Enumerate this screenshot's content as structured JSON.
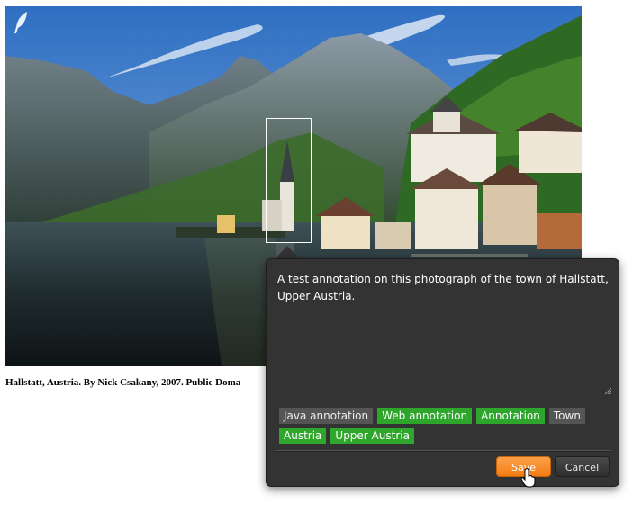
{
  "image": {
    "caption": "Hallstatt, Austria. By Nick Csakany, 2007. Public Doma"
  },
  "annotation_editor": {
    "text": "A test annotation on this photograph of the town of Hallstatt, Upper Austria.",
    "tags": [
      {
        "label": "Java annotation",
        "style": "plain"
      },
      {
        "label": "Web annotation",
        "style": "linked"
      },
      {
        "label": "Annotation",
        "style": "linked"
      },
      {
        "label": "Town",
        "style": "plain"
      },
      {
        "label": "Austria",
        "style": "linked"
      },
      {
        "label": "Upper Austria",
        "style": "linked"
      }
    ],
    "save_label": "Save",
    "cancel_label": "Cancel"
  },
  "icons": {
    "annotate_tool": "feather-icon",
    "resize": "resize-grip-icon",
    "pointer": "hand-pointer-icon"
  },
  "colors": {
    "editor_bg": "#333333",
    "tag_linked": "#2ea52b",
    "tag_plain": "#555555",
    "save_button": "#f47c10"
  }
}
